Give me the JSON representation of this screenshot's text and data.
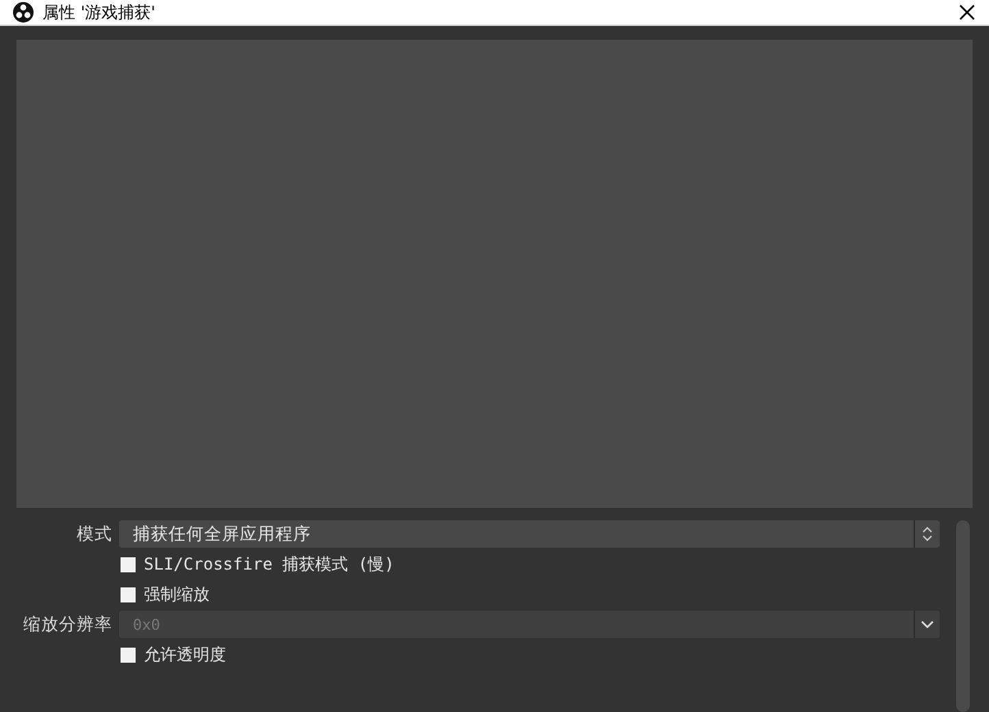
{
  "window": {
    "title": "属性 '游戏捕获'"
  },
  "properties": [
    {
      "kind": "spin-select",
      "label": "模式",
      "value": "捕获任何全屏应用程序",
      "disabled": false
    },
    {
      "kind": "checkbox",
      "label": "SLI/Crossfire 捕获模式 (慢)",
      "checked": false
    },
    {
      "kind": "checkbox",
      "label": "强制缩放",
      "checked": false
    },
    {
      "kind": "select",
      "label": "缩放分辨率",
      "value": "0x0",
      "disabled": true
    },
    {
      "kind": "checkbox",
      "label": "允许透明度",
      "checked": false
    }
  ]
}
